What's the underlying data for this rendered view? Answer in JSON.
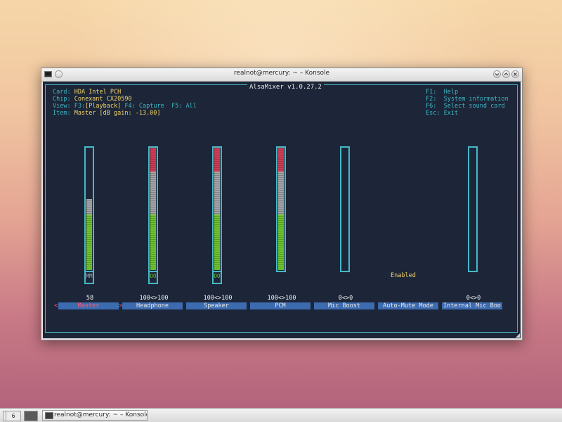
{
  "window": {
    "title": "realnot@mercury: ~ – Konsole"
  },
  "mixer": {
    "header_title": "AlsaMixer v1.0.27.2",
    "info": {
      "card_label": "Card:",
      "card_value": "HDA Intel PCH",
      "chip_label": "Chip:",
      "chip_value": "Conexant CX20590",
      "view_label": "View:",
      "view_f3": "F3:",
      "view_playback": "[Playback]",
      "view_f4": "F4:",
      "view_capture": "Capture",
      "view_f5": "F5:",
      "view_all": "All",
      "item_label": "Item:",
      "item_value": "Master [dB gain: -13.00]"
    },
    "help": {
      "f1_key": "F1:",
      "f1_text": "Help",
      "f2_key": "F2:",
      "f2_text": "System information",
      "f6_key": "F6:",
      "f6_text": "Select sound card",
      "esc_key": "Esc:",
      "esc_text": "Exit"
    },
    "channels": [
      {
        "name": "Master",
        "value": "58",
        "level": 0.58,
        "has_bar": true,
        "mute": "MM",
        "selected": true
      },
      {
        "name": "Headphone",
        "value": "100<>100",
        "level": 1.0,
        "has_bar": true,
        "mute": "OO",
        "selected": false
      },
      {
        "name": "Speaker",
        "value": "100<>100",
        "level": 1.0,
        "has_bar": true,
        "mute": "OO",
        "selected": false
      },
      {
        "name": "PCM",
        "value": "100<>100",
        "level": 1.0,
        "has_bar": true,
        "mute": "",
        "selected": false
      },
      {
        "name": "Mic Boost",
        "value": "0<>0",
        "level": 0.0,
        "has_bar": true,
        "mute": "",
        "selected": false
      },
      {
        "name": "Auto-Mute Mode",
        "value": "",
        "level": 0.0,
        "has_bar": false,
        "mute": "",
        "state": "Enabled",
        "selected": false
      },
      {
        "name": "Internal Mic Boo",
        "value": "0<>0",
        "level": 0.0,
        "has_bar": true,
        "mute": "",
        "selected": false
      }
    ],
    "selection_left": "<",
    "selection_right": ">"
  },
  "taskbar": {
    "pager": [
      "",
      "6",
      ""
    ],
    "task_label": "realnot@mercury: ~ – Konsole"
  },
  "colors": {
    "terminal_bg": "#1c2638",
    "frame": "#46b9c6",
    "green": "#6fc42d",
    "gray": "#a4a4a4",
    "red": "#d23d55",
    "yellow": "#f4d36a",
    "tab_blue": "#3d6bb0"
  }
}
